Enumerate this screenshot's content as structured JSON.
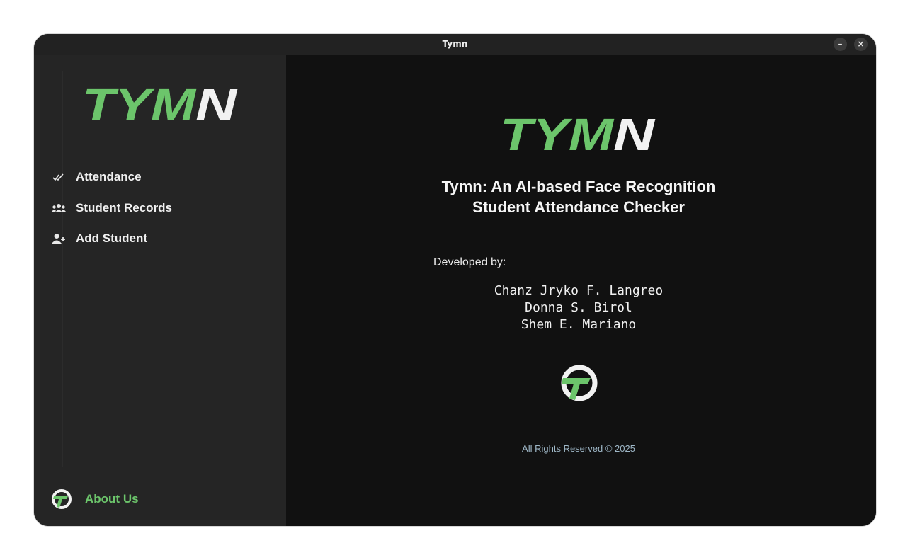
{
  "window": {
    "title": "Tymn",
    "minimize_glyph": "–",
    "close_glyph": "×"
  },
  "brand": {
    "logo_text_green": "TYM",
    "logo_text_white": "N",
    "green": "#6cc56b",
    "white": "#f2f2f2"
  },
  "sidebar": {
    "items": [
      {
        "label": "Attendance",
        "icon": "double-check-icon"
      },
      {
        "label": "Student Records",
        "icon": "users-icon"
      },
      {
        "label": "Add Student",
        "icon": "user-plus-icon"
      }
    ],
    "about": {
      "label": "About Us",
      "icon": "tymn-emblem-icon"
    }
  },
  "main": {
    "title_line1": "Tymn: An AI-based Face Recognition",
    "title_line2": "Student Attendance Checker",
    "developed_by_label": "Developed by:",
    "developers": [
      "Chanz Jryko F. Langreo",
      "Donna S. Birol",
      "Shem E. Mariano"
    ],
    "copyright": "All Rights Reserved © 2025"
  }
}
